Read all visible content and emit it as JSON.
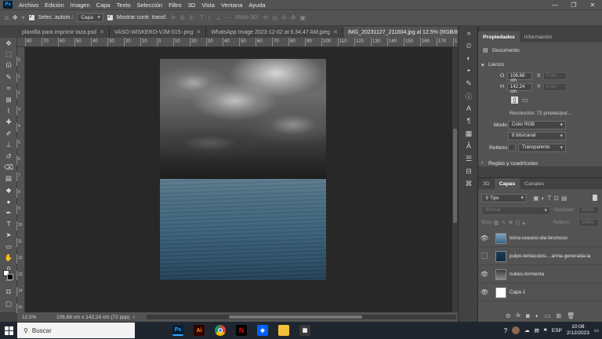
{
  "menubar": {
    "logo": "Ps",
    "items": [
      "Archivo",
      "Edición",
      "Imagen",
      "Capa",
      "Texto",
      "Selección",
      "Filtro",
      "3D",
      "Vista",
      "Ventana",
      "Ayuda"
    ],
    "window_controls": [
      "—",
      "❐",
      "✕"
    ]
  },
  "options": {
    "auto_select_label": "Selec. autom.:",
    "auto_select_value": "Capa",
    "transform_label": "Mostrar contr. transf.",
    "mode3d": "Modo 3D:"
  },
  "tabs": [
    {
      "label": "plantilla para imprimir taza.psd",
      "active": false
    },
    {
      "label": "VASO-WISKERO-VJM-015-.png",
      "active": false
    },
    {
      "label": "WhatsApp Image 2023-12-02 at 6.34.47 AM.jpeg",
      "active": false
    },
    {
      "label": "IMG_20231127_211604.jpg al 12.5% (RGB/8*) *",
      "active": true
    }
  ],
  "ruler_h": [
    "80",
    "70",
    "60",
    "50",
    "40",
    "30",
    "20",
    "10",
    "0",
    "10",
    "20",
    "30",
    "40",
    "50",
    "60",
    "70",
    "80",
    "90",
    "100",
    "110",
    "120",
    "130",
    "140",
    "150",
    "160",
    "170",
    "180"
  ],
  "ruler_v": [
    "0",
    "1",
    "2",
    "3",
    "4",
    "5",
    "6",
    "7",
    "8",
    "9",
    "10",
    "11",
    "12",
    "13",
    "14",
    "15"
  ],
  "status": {
    "zoom": "12,5%",
    "info": "106,68 cm x 142,24 cm (72 ppp)"
  },
  "properties": {
    "tab_props": "Propiedades",
    "tab_info": "Información",
    "doc_label": "Documento",
    "section_canvas": "Lienzo",
    "w_label": "O",
    "w_value": "106,68 cm",
    "h_label": "H",
    "h_value": "142,24 cm",
    "x_label": "X",
    "x_value": "0 cm",
    "y_label": "Y",
    "y_value": "0 cm",
    "resolution": "Resolución: 72 píxeles/pul...",
    "mode_label": "Modo",
    "mode_value": "Color RGB",
    "depth_value": "8 bits/canal",
    "fill_label": "Relleno",
    "fill_value": "Transparente",
    "section_rulers": "Reglas y cuadrículas"
  },
  "layers_panel": {
    "tab_3d": "3D",
    "tab_layers": "Capas",
    "tab_channels": "Canales",
    "kind": "Tipo",
    "blend": "Normal",
    "opacity_label": "Opacidad:",
    "opacity_value": "100%",
    "lock_label": "Bloq.:",
    "fill_label": "Relleno:",
    "fill_value": "100%",
    "layers": [
      {
        "name": "toma-oceano-dia-brumoso",
        "visible": true
      },
      {
        "name": "pulpo-tentaculos-...arina-generada-ia",
        "visible": false
      },
      {
        "name": "nubes-tormenta",
        "visible": true
      },
      {
        "name": "Capa 1",
        "visible": true
      }
    ]
  },
  "taskbar": {
    "search_placeholder": "Buscar",
    "lang": "ESP",
    "time": "10:08",
    "date": "2/12/2023"
  },
  "colors": {
    "panel": "#535353",
    "canvas": "#282828",
    "taskbar": "#1f2630",
    "ps_blue": "#31a8ff"
  }
}
